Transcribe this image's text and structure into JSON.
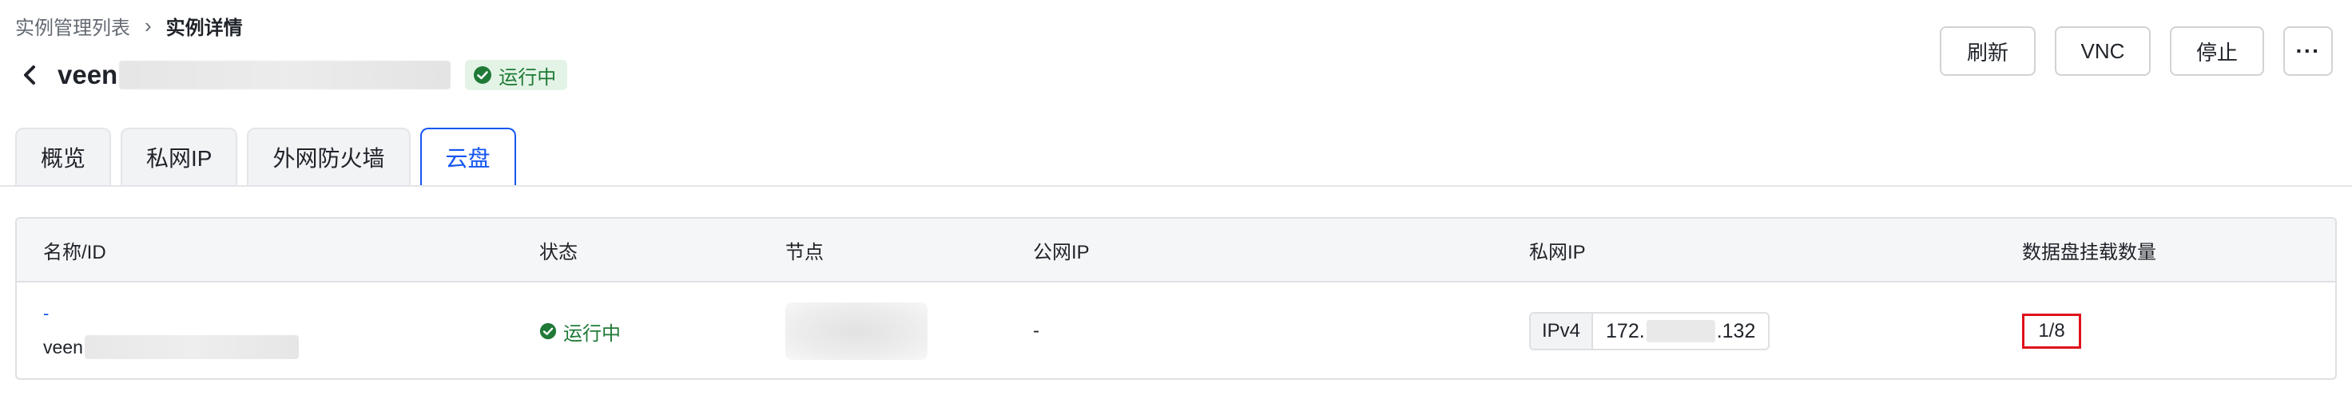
{
  "breadcrumb": {
    "parent": "实例管理列表",
    "current": "实例详情"
  },
  "instance": {
    "name_prefix": "veen",
    "status": "运行中"
  },
  "actions": {
    "refresh": "刷新",
    "vnc": "VNC",
    "stop": "停止",
    "more": "···"
  },
  "tabs": [
    {
      "label": "概览"
    },
    {
      "label": "私网IP"
    },
    {
      "label": "外网防火墙"
    },
    {
      "label": "云盘",
      "active": true
    }
  ],
  "table": {
    "headers": [
      "名称/ID",
      "状态",
      "节点",
      "公网IP",
      "私网IP",
      "数据盘挂载数量"
    ],
    "rows": [
      {
        "name_link": "-",
        "name_prefix": "veen",
        "status": "运行中",
        "public_ip": "-",
        "private_ip_type": "IPv4",
        "private_ip_start": "172.",
        "private_ip_end": ".132",
        "disk_count": "1/8"
      }
    ]
  },
  "colors": {
    "accent": "#1456f0",
    "success": "#1f7a36",
    "success_bg": "#e3f4e6",
    "highlight": "#e0111b"
  }
}
